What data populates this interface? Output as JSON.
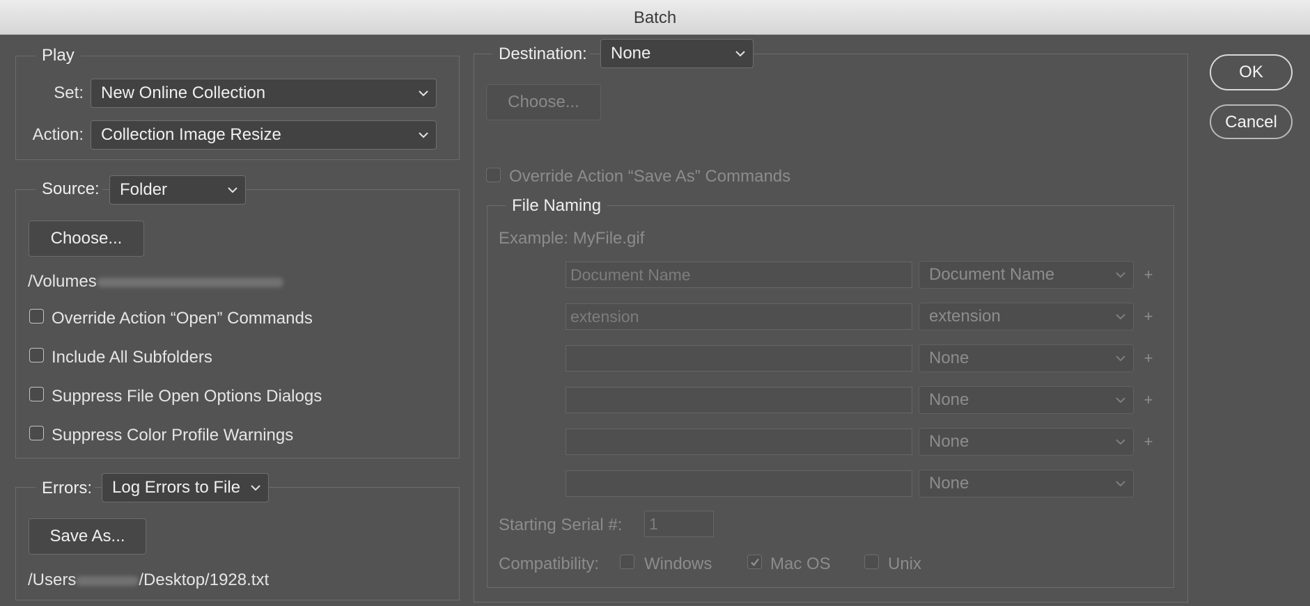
{
  "window": {
    "title": "Batch"
  },
  "play": {
    "legend": "Play",
    "set_label": "Set:",
    "set_value": "New Online Collection",
    "action_label": "Action:",
    "action_value": "Collection Image Resize"
  },
  "source": {
    "label": "Source:",
    "value": "Folder",
    "choose_label": "Choose...",
    "path_prefix": "/Volumes",
    "options": [
      {
        "label": "Override Action “Open” Commands",
        "checked": false
      },
      {
        "label": "Include All Subfolders",
        "checked": false
      },
      {
        "label": "Suppress File Open Options Dialogs",
        "checked": false
      },
      {
        "label": "Suppress Color Profile Warnings",
        "checked": false
      }
    ]
  },
  "errors": {
    "label": "Errors:",
    "value": "Log Errors to File",
    "save_as_label": "Save As...",
    "path_prefix": "/Users",
    "path_suffix": "/Desktop/1928.txt"
  },
  "destination": {
    "label": "Destination:",
    "value": "None",
    "choose_label": "Choose...",
    "override_label": "Override Action “Save As” Commands",
    "override_checked": false
  },
  "file_naming": {
    "legend": "File Naming",
    "example": "Example: MyFile.gif",
    "rows": [
      {
        "text": "Document Name",
        "select": "Document Name",
        "plus": "+"
      },
      {
        "text": "extension",
        "select": "extension",
        "plus": "+"
      },
      {
        "text": "",
        "select": "None",
        "plus": "+"
      },
      {
        "text": "",
        "select": "None",
        "plus": "+"
      },
      {
        "text": "",
        "select": "None",
        "plus": "+"
      },
      {
        "text": "",
        "select": "None",
        "plus": ""
      }
    ],
    "serial_label": "Starting Serial #:",
    "serial_value": "1",
    "compat_label": "Compatibility:",
    "compat": [
      {
        "label": "Windows",
        "checked": false
      },
      {
        "label": "Mac OS",
        "checked": true
      },
      {
        "label": "Unix",
        "checked": false
      }
    ]
  },
  "buttons": {
    "ok": "OK",
    "cancel": "Cancel"
  },
  "colors": {
    "background": "#535353",
    "titlebar": "#e4e4e4",
    "text": "#e6e6e6",
    "disabled_text": "#8c8c8c"
  }
}
